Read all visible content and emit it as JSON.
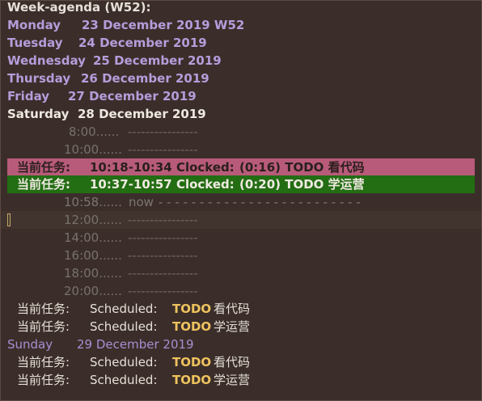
{
  "agenda": {
    "title": "Week-agenda (W52):",
    "days": {
      "monday": {
        "name": "Monday",
        "date": "23 December 2019 W52"
      },
      "tuesday": {
        "name": "Tuesday",
        "date": "24 December 2019"
      },
      "wednesday": {
        "name": "Wednesday",
        "date": "25 December 2019"
      },
      "thursday": {
        "name": "Thursday",
        "date": "26 December 2019"
      },
      "friday": {
        "name": "Friday",
        "date": "27 December 2019"
      },
      "saturday": {
        "name": "Saturday",
        "date": "28 December 2019"
      },
      "sunday": {
        "name": "Sunday",
        "date": "29 December 2019"
      }
    },
    "grid": {
      "t0800": {
        "time": "8:00......",
        "dashes": "----------------"
      },
      "t1000": {
        "time": "10:00......",
        "dashes": "----------------"
      },
      "t1200": {
        "time": "12:00......",
        "dashes": "----------------"
      },
      "t1400": {
        "time": "14:00......",
        "dashes": "----------------"
      },
      "t1600": {
        "time": "16:00......",
        "dashes": "----------------"
      },
      "t1800": {
        "time": "18:00......",
        "dashes": "----------------"
      },
      "t2000": {
        "time": "20:00......",
        "dashes": "----------------"
      }
    },
    "now": {
      "time": "10:58......",
      "label": "now",
      "dashes": "- - - - - - - - - - - - - - - - - - - - - - - - -"
    },
    "clocked": [
      {
        "category": "当前任务:",
        "range": "10:18-10:34 Clocked:",
        "duration": "(0:16) TODO 看代码"
      },
      {
        "category": "当前任务:",
        "range": "10:37-10:57 Clocked:",
        "duration": "(0:20) TODO 学运营"
      }
    ],
    "saturday_scheduled": [
      {
        "category": "当前任务:",
        "label": "Scheduled:",
        "keyword": "TODO",
        "task": "看代码"
      },
      {
        "category": "当前任务:",
        "label": "Scheduled:",
        "keyword": "TODO",
        "task": "学运营"
      }
    ],
    "sunday_scheduled": [
      {
        "category": "当前任务:",
        "label": "Scheduled:",
        "keyword": "TODO",
        "task": "看代码"
      },
      {
        "category": "当前任务:",
        "label": "Scheduled:",
        "keyword": "TODO",
        "task": "学运营"
      }
    ]
  },
  "colors": {
    "background": "#3b2e2a",
    "day": "#b59ddb",
    "todo": "#efc35f",
    "clock_pink": "#b85b7a",
    "clock_green": "#236d13"
  }
}
